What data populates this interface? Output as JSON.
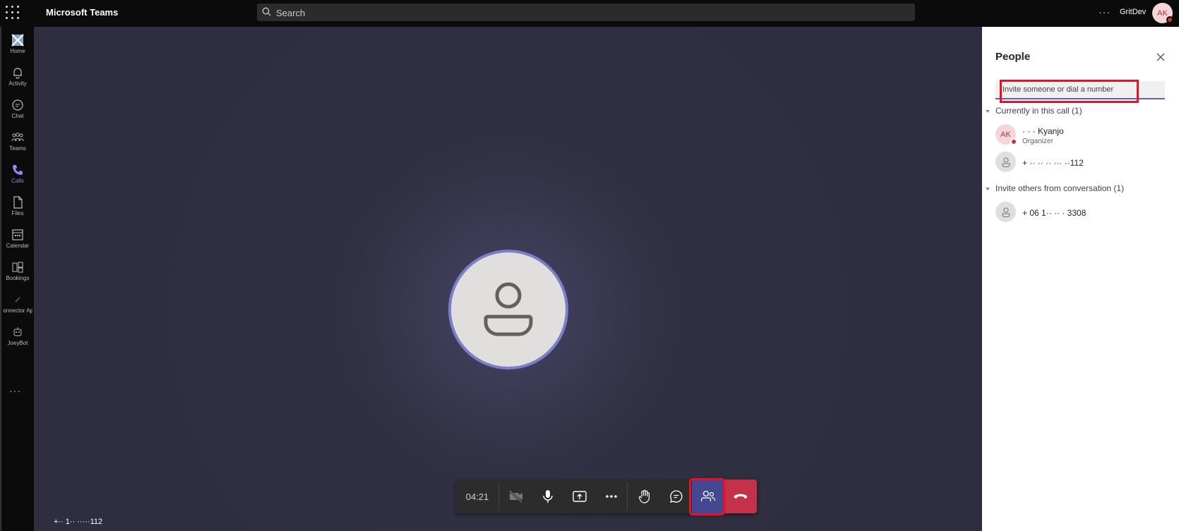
{
  "topbar": {
    "app_title": "Microsoft Teams",
    "search_placeholder": "Search",
    "more_label": "···",
    "org_name": "GritDev",
    "user_initials": "AK"
  },
  "rail": {
    "items": [
      {
        "label": "Home",
        "icon": "home-icon"
      },
      {
        "label": "Activity",
        "icon": "bell-icon"
      },
      {
        "label": "Chat",
        "icon": "chat-icon"
      },
      {
        "label": "Teams",
        "icon": "teams-icon"
      },
      {
        "label": "Calls",
        "icon": "phone-icon",
        "active": true
      },
      {
        "label": "Files",
        "icon": "file-icon"
      },
      {
        "label": "Calendar",
        "icon": "calendar-icon"
      },
      {
        "label": "Bookings",
        "icon": "bookings-icon"
      },
      {
        "label": "Connector App",
        "icon": "connector-icon"
      },
      {
        "label": "JoeyBot",
        "icon": "bot-icon"
      }
    ],
    "more_label": "···"
  },
  "stage": {
    "caller_label": "+·· 1·· ·····112"
  },
  "callbar": {
    "timer": "04:21"
  },
  "panel": {
    "title": "People",
    "invite_placeholder": "Invite someone or dial a number",
    "current_section": "Currently in this call (1)",
    "invite_section": "Invite others from conversation (1)",
    "participants": [
      {
        "initials": "AK",
        "name": "·  ·  · Kyanjo",
        "role": "Organizer"
      },
      {
        "initials": "",
        "name": "+ ·· ·· ·· ··· ··112",
        "role": ""
      }
    ],
    "invitees": [
      {
        "initials": "",
        "name": "+ 06 1·· ·· · 3308"
      }
    ]
  },
  "colors": {
    "accent": "#444791",
    "hangup": "#c4314b",
    "highlight": "#e81123",
    "stage": "#2e2e40"
  }
}
